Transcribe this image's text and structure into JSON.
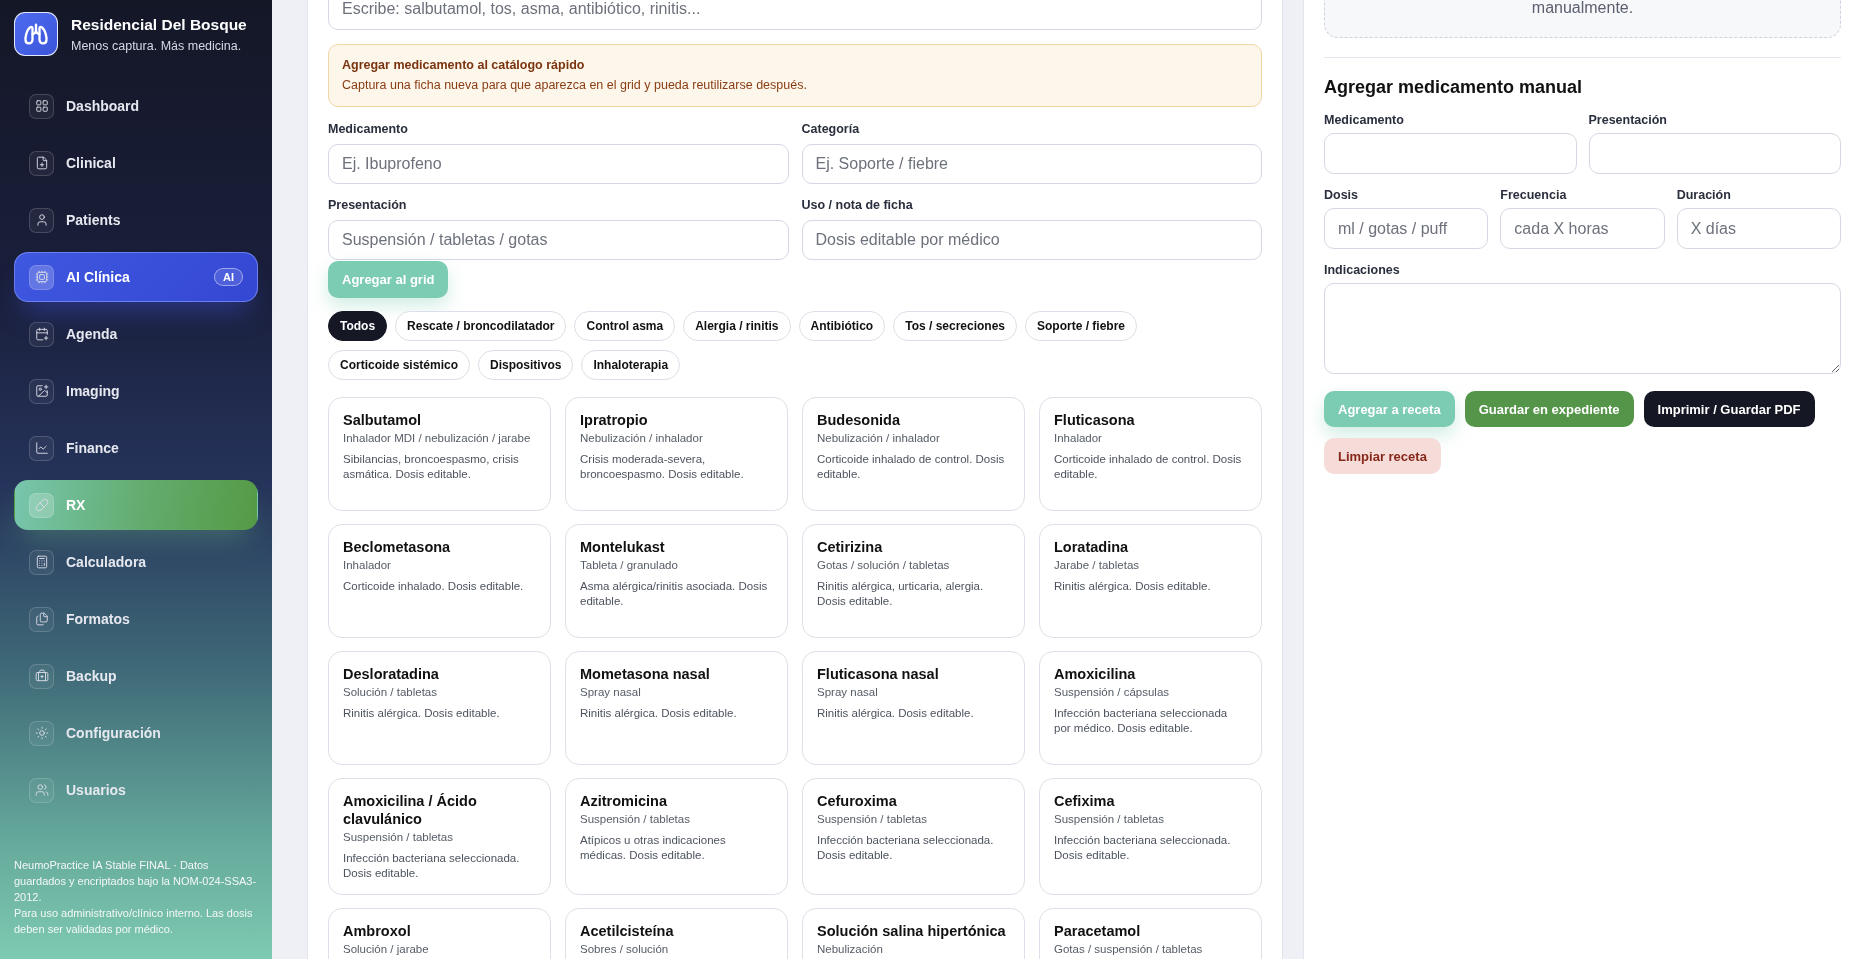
{
  "sidebar": {
    "brand": {
      "title": "Residencial Del Bosque",
      "tagline": "Menos captura. Más medicina."
    },
    "nav": [
      {
        "label": "Dashboard",
        "kind": "link",
        "selected": false
      },
      {
        "label": "Clinical",
        "kind": "link",
        "selected": false
      },
      {
        "label": "Patients",
        "kind": "link",
        "selected": false
      },
      {
        "label": "AI Clínica",
        "kind": "ai",
        "badge": "AI",
        "selected": false
      },
      {
        "label": "Agenda",
        "kind": "link",
        "selected": false
      },
      {
        "label": "Imaging",
        "kind": "link",
        "selected": false
      },
      {
        "label": "Finance",
        "kind": "link",
        "selected": false
      },
      {
        "label": "RX",
        "kind": "link",
        "selected": true
      },
      {
        "label": "Calculadora",
        "kind": "link",
        "selected": false
      },
      {
        "label": "Formatos",
        "kind": "link",
        "selected": false
      },
      {
        "label": "Backup",
        "kind": "link",
        "selected": false
      },
      {
        "label": "Configuración",
        "kind": "link",
        "selected": false
      },
      {
        "label": "Usuarios",
        "kind": "link",
        "selected": false
      }
    ],
    "footer": [
      "NeumoPractice IA Stable FINAL · Datos guardados y encriptados bajo la NOM-024-SSA3-2012.",
      "Para uso administrativo/clínico interno. Las dosis deben ser validadas por médico."
    ]
  },
  "catalog": {
    "search": {
      "placeholder": "Escribe: salbutamol, tos, asma, antibiótico, rinitis..."
    },
    "notice": {
      "title": "Agregar medicamento al catálogo rápido",
      "text": "Captura una ficha nueva para que aparezca en el grid y pueda reutilizarse después."
    },
    "form": {
      "fields": [
        {
          "label": "Medicamento",
          "placeholder": "Ej. Ibuprofeno"
        },
        {
          "label": "Categoría",
          "placeholder": "Ej. Soporte / fiebre"
        },
        {
          "label": "Presentación",
          "placeholder": "Suspensión / tabletas / gotas"
        },
        {
          "label": "Uso / nota de ficha",
          "placeholder": "Dosis editable por médico"
        }
      ],
      "button": "Agregar al grid"
    },
    "filters": [
      {
        "label": "Todos",
        "selected": true
      },
      {
        "label": "Rescate / broncodilatador",
        "selected": false
      },
      {
        "label": "Control asma",
        "selected": false
      },
      {
        "label": "Alergia / rinitis",
        "selected": false
      },
      {
        "label": "Antibiótico",
        "selected": false
      },
      {
        "label": "Tos / secreciones",
        "selected": false
      },
      {
        "label": "Soporte / fiebre",
        "selected": false
      },
      {
        "label": "Corticoide sistémico",
        "selected": false
      },
      {
        "label": "Dispositivos",
        "selected": false
      },
      {
        "label": "Inhaloterapia",
        "selected": false
      }
    ],
    "medications": [
      {
        "name": "Salbutamol",
        "presentation": "Inhalador MDI / nebulización / jarabe",
        "note": "Sibilancias, broncoespasmo, crisis asmática. Dosis editable."
      },
      {
        "name": "Ipratropio",
        "presentation": "Nebulización / inhalador",
        "note": "Crisis moderada-severa, broncoespasmo. Dosis editable."
      },
      {
        "name": "Budesonida",
        "presentation": "Nebulización / inhalador",
        "note": "Corticoide inhalado de control. Dosis editable."
      },
      {
        "name": "Fluticasona",
        "presentation": "Inhalador",
        "note": "Corticoide inhalado de control. Dosis editable."
      },
      {
        "name": "Beclometasona",
        "presentation": "Inhalador",
        "note": "Corticoide inhalado. Dosis editable."
      },
      {
        "name": "Montelukast",
        "presentation": "Tableta / granulado",
        "note": "Asma alérgica/rinitis asociada. Dosis editable."
      },
      {
        "name": "Cetirizina",
        "presentation": "Gotas / solución / tabletas",
        "note": "Rinitis alérgica, urticaria, alergia. Dosis editable."
      },
      {
        "name": "Loratadina",
        "presentation": "Jarabe / tabletas",
        "note": "Rinitis alérgica. Dosis editable."
      },
      {
        "name": "Desloratadina",
        "presentation": "Solución / tabletas",
        "note": "Rinitis alérgica. Dosis editable."
      },
      {
        "name": "Mometasona nasal",
        "presentation": "Spray nasal",
        "note": "Rinitis alérgica. Dosis editable."
      },
      {
        "name": "Fluticasona nasal",
        "presentation": "Spray nasal",
        "note": "Rinitis alérgica. Dosis editable."
      },
      {
        "name": "Amoxicilina",
        "presentation": "Suspensión / cápsulas",
        "note": "Infección bacteriana seleccionada por médico. Dosis editable."
      },
      {
        "name": "Amoxicilina / Ácido clavulánico",
        "presentation": "Suspensión / tabletas",
        "note": "Infección bacteriana seleccionada. Dosis editable."
      },
      {
        "name": "Azitromicina",
        "presentation": "Suspensión / tabletas",
        "note": "Atípicos u otras indicaciones médicas. Dosis editable."
      },
      {
        "name": "Cefuroxima",
        "presentation": "Suspensión / tabletas",
        "note": "Infección bacteriana seleccionada. Dosis editable."
      },
      {
        "name": "Cefixima",
        "presentation": "Suspensión / tabletas",
        "note": "Infección bacteriana seleccionada. Dosis editable."
      },
      {
        "name": "Ambroxol",
        "presentation": "Solución / jarabe"
      },
      {
        "name": "Acetilcisteína",
        "presentation": "Sobres / solución"
      },
      {
        "name": "Solución salina hipertónica",
        "presentation": "Nebulización"
      },
      {
        "name": "Paracetamol",
        "presentation": "Gotas / suspensión / tabletas"
      }
    ]
  },
  "manual": {
    "hint": "manualmente.",
    "title": "Agregar medicamento manual",
    "fields": [
      {
        "label": "Medicamento"
      },
      {
        "label": "Presentación"
      },
      {
        "label": "Dosis",
        "placeholder": "ml / gotas / puff"
      },
      {
        "label": "Frecuencia",
        "placeholder": "cada X horas"
      },
      {
        "label": "Duración",
        "placeholder": "X días"
      }
    ],
    "notes": {
      "label": "Indicaciones"
    },
    "buttons": [
      {
        "label": "Agregar a receta",
        "kind": "add"
      },
      {
        "label": "Guardar en expediente",
        "kind": "save"
      },
      {
        "label": "Imprimir / Guardar PDF",
        "kind": "print"
      },
      {
        "label": "Limpiar receta",
        "kind": "clear"
      }
    ]
  }
}
